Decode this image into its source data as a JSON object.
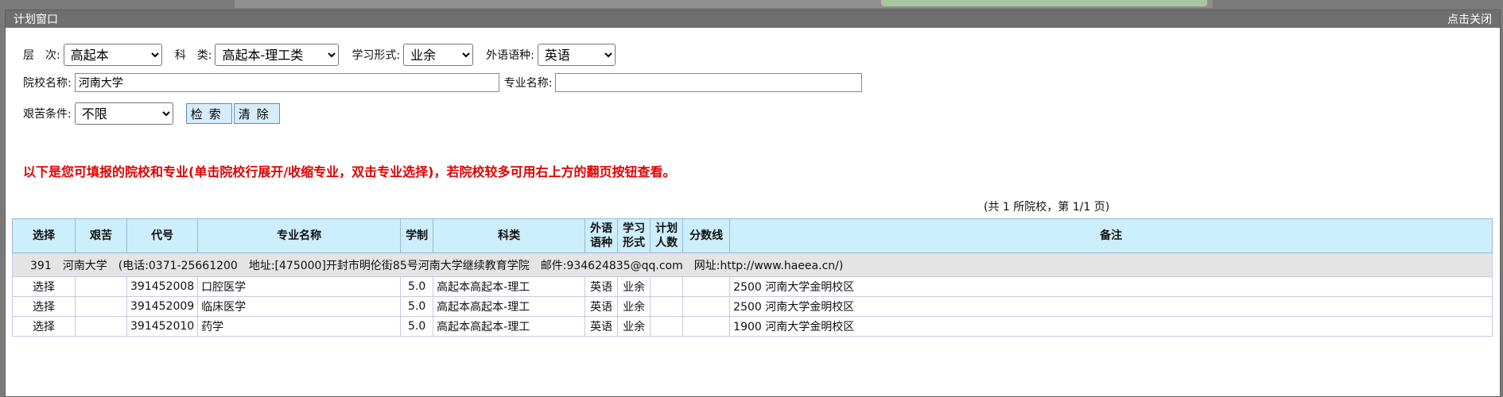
{
  "window": {
    "title": "计划窗口",
    "close_label": "点击关闭"
  },
  "filters": {
    "level_label": "层　次:",
    "level_value": "高起本",
    "category_label": "科　类:",
    "category_value": "高起本-理工类",
    "study_form_label": "学习形式:",
    "study_form_value": "业余",
    "language_label": "外语语种:",
    "language_value": "英语",
    "school_label": "院校名称:",
    "school_value": "河南大学",
    "major_label": "专业名称:",
    "major_value": "",
    "hardship_label": "艰苦条件:",
    "hardship_value": "不限",
    "search_label": "检索",
    "clear_label": "清除"
  },
  "notice": "以下是您可填报的院校和专业(单击院校行展开/收缩专业，双击专业选择)，若院校较多可用右上方的翻页按钮查看。",
  "pager": "(共 1 所院校，第 1/1 页)",
  "table": {
    "headers": {
      "select": "选择",
      "hardship": "艰苦",
      "code": "代号",
      "major": "专业名称",
      "duration": "学制",
      "category": "科类",
      "language_1": "外语",
      "language_2": "语种",
      "form_1": "学习",
      "form_2": "形式",
      "plan_1": "计划",
      "plan_2": "人数",
      "score": "分数线",
      "remark": "备注"
    },
    "school_row": "391　河南大学　(电话:0371-25661200　地址:[475000]开封市明伦街85号河南大学继续教育学院　邮件:934624835@qq.com　网址:http://www.haeea.cn/)",
    "rows": [
      {
        "select": "选择",
        "hardship": "",
        "code": "391452008",
        "major": "口腔医学",
        "duration": "5.0",
        "category": "高起本高起本-理工",
        "language": "英语",
        "form": "业余",
        "plan": "",
        "score": "",
        "remark": "2500 河南大学金明校区"
      },
      {
        "select": "选择",
        "hardship": "",
        "code": "391452009",
        "major": "临床医学",
        "duration": "5.0",
        "category": "高起本高起本-理工",
        "language": "英语",
        "form": "业余",
        "plan": "",
        "score": "",
        "remark": "2500 河南大学金明校区"
      },
      {
        "select": "选择",
        "hardship": "",
        "code": "391452010",
        "major": "药学",
        "duration": "5.0",
        "category": "高起本高起本-理工",
        "language": "英语",
        "form": "业余",
        "plan": "",
        "score": "",
        "remark": "1900 河南大学金明校区"
      }
    ]
  }
}
